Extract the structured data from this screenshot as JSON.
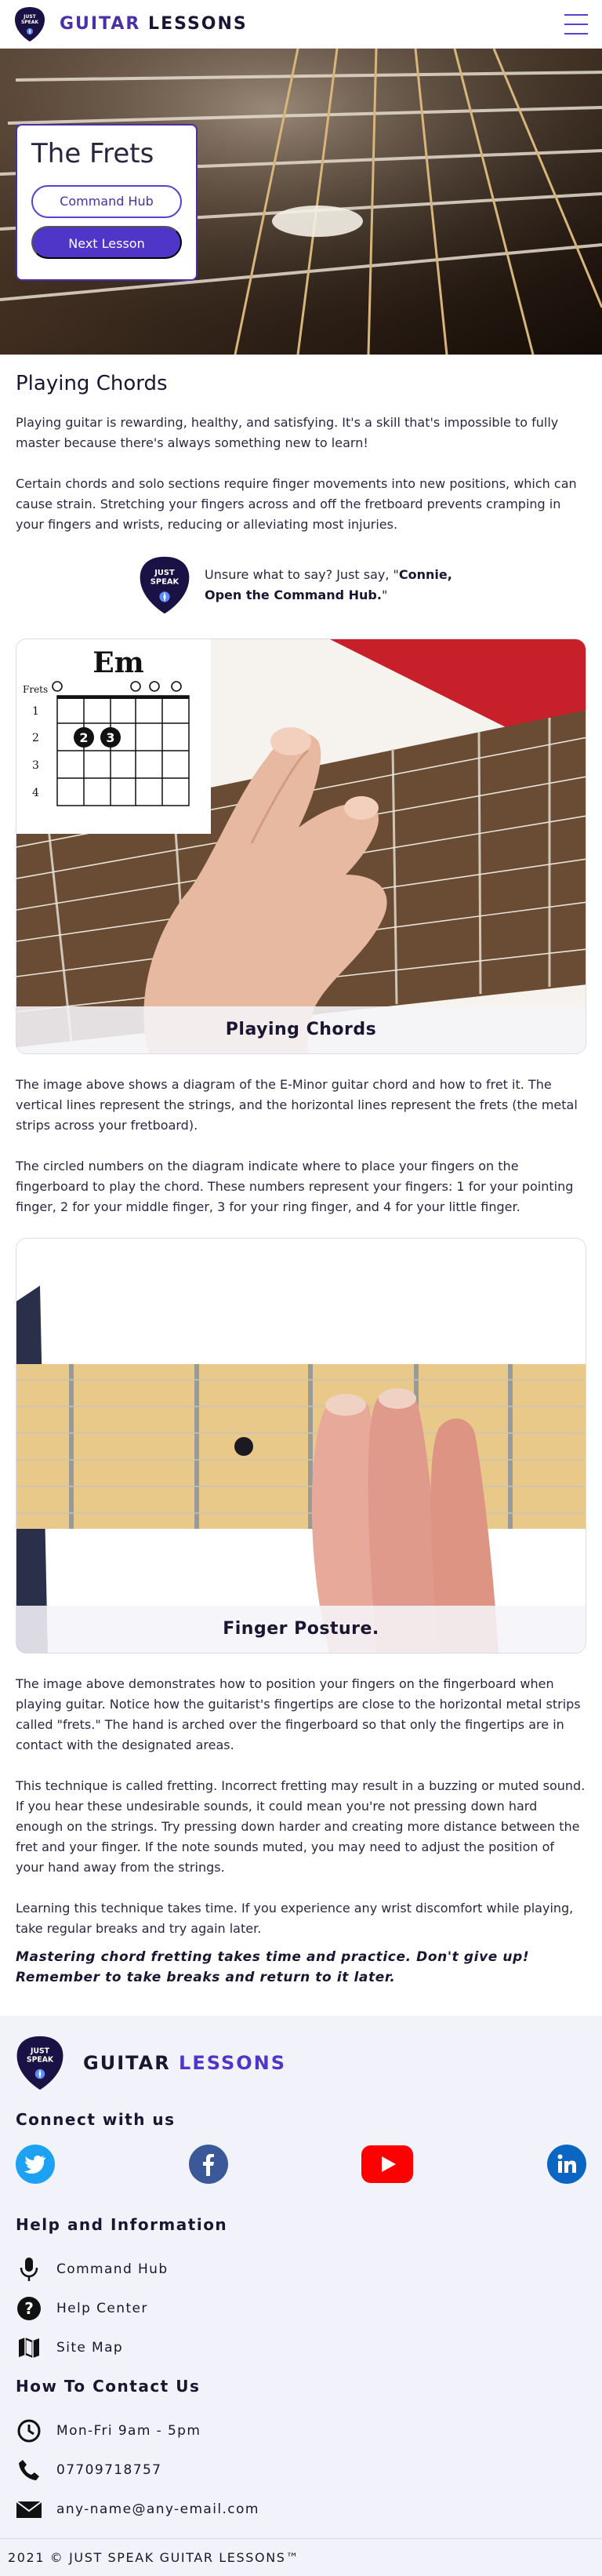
{
  "header": {
    "logo_badge": {
      "line1": "JUST",
      "line2": "SPEAK"
    },
    "brand_word1": "GUITAR",
    "brand_word2": "LESSONS",
    "menu_icon": "hamburger-icon"
  },
  "hero": {
    "title": "The Frets",
    "primary_button": "Command Hub",
    "secondary_button": "Next Lesson"
  },
  "article": {
    "section_title": "Playing Chords",
    "paragraphs_top": [
      "Playing guitar is rewarding, healthy, and satisfying. It's a skill that's impossible to fully master because there's always something new to learn!",
      "Certain chords and solo sections require finger movements into new positions, which can cause strain. Stretching your fingers across and off the fretboard prevents cramping in your fingers and wrists, reducing or alleviating most injuries."
    ],
    "tip": {
      "lead": "Unsure what to say? Just say, \"",
      "command": "Connie, Open the Command Hub.",
      "tail": "\""
    },
    "figure1": {
      "caption": "Playing Chords",
      "chord_name": "Em",
      "frets_label": "Frets",
      "fret_numbers": [
        "1",
        "2",
        "3",
        "4"
      ],
      "finger_labels": [
        "2",
        "3"
      ]
    },
    "paragraphs_mid": [
      "The image above shows a diagram of the E-Minor guitar chord and how to fret it. The vertical lines represent the strings, and the horizontal lines represent the frets (the metal strips across your fretboard).",
      "The circled numbers on the diagram indicate where to place your fingers on the fingerboard to play the chord. These numbers represent your fingers: 1 for your pointing finger, 2 for your middle finger, 3 for your ring finger, and 4 for your little finger."
    ],
    "figure2": {
      "caption": "Finger Posture."
    },
    "paragraphs_bottom": [
      "The image above demonstrates how to position your fingers on the fingerboard when playing guitar. Notice how the guitarist's fingertips are close to the horizontal metal strips called \"frets.\" The hand is arched over the fingerboard so that only the fingertips are in contact with the designated areas.",
      "This technique is called fretting. Incorrect fretting may result in a buzzing or muted sound. If you hear these undesirable sounds, it could mean you're not pressing down hard enough on the strings. Try pressing down harder and creating more distance between the fret and your finger. If the note sounds muted, you may need to adjust the position of your hand away from the strings.",
      "Learning this technique takes time. If you experience any wrist discomfort while playing, take regular breaks and try again later."
    ],
    "emphasis": "Mastering chord fretting takes time and practice. Don't give up! Remember to take breaks and return to it later."
  },
  "footer": {
    "brand_word1": "GUITAR",
    "brand_word2": "LESSONS",
    "connect_heading": "Connect with us",
    "social_icons": [
      "twitter-icon",
      "facebook-icon",
      "youtube-icon",
      "linkedin-icon"
    ],
    "help_heading": "Help and Information",
    "help_items": [
      {
        "label": "Command Hub",
        "icon": "microphone-icon"
      },
      {
        "label": "Help Center",
        "icon": "help-circle-icon"
      },
      {
        "label": "Site Map",
        "icon": "map-icon"
      }
    ],
    "contact_heading": "How To Contact Us",
    "contact_items": [
      {
        "label": "Mon-Fri 9am - 5pm",
        "icon": "clock-icon"
      },
      {
        "label": "07709718757",
        "icon": "phone-icon"
      },
      {
        "label": "any-name@any-email.com",
        "icon": "email-icon"
      }
    ],
    "copyright": "2021 © JUST SPEAK GUITAR LESSONS™"
  },
  "colors": {
    "brand_purple": "#4f36c8",
    "dark_navy": "#1a1530",
    "footer_bg": "#f2f3fa",
    "twitter": "#1da1f2",
    "facebook": "#3b5998",
    "youtube": "#ff0000",
    "linkedin": "#0a66c2"
  }
}
